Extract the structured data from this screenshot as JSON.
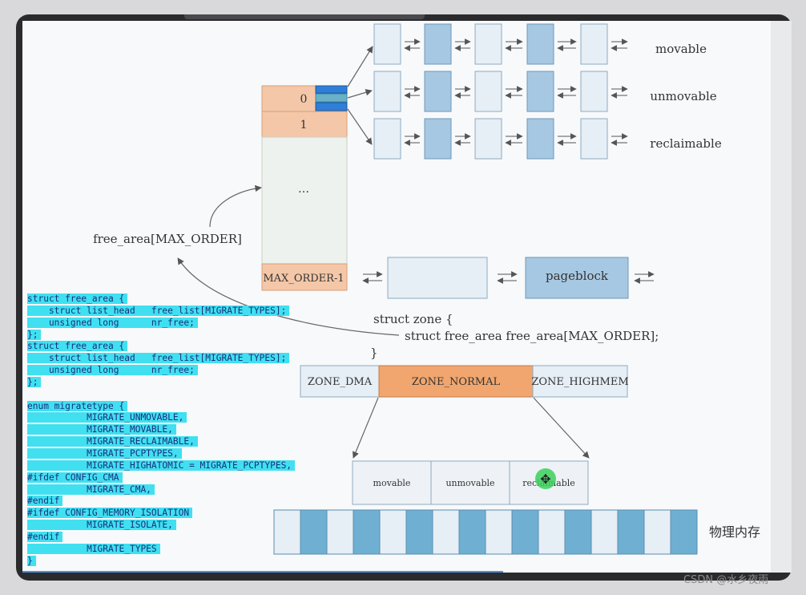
{
  "free_area_column": {
    "order_labels": [
      "0",
      "1",
      "…",
      "MAX_ORDER-1"
    ]
  },
  "migrate_rows": [
    {
      "label": "movable"
    },
    {
      "label": "unmovable"
    },
    {
      "label": "reclaimable"
    }
  ],
  "free_area_label": "free_area[MAX_ORDER]",
  "pageblock_label": "pageblock",
  "struct_zone": {
    "line1": "struct zone {",
    "line2": "struct free_area free_area[MAX_ORDER];",
    "line3": "}"
  },
  "zones": [
    "ZONE_DMA",
    "ZONE_NORMAL",
    "ZONE_HIGHMEM"
  ],
  "migrate_boxes": [
    "movable",
    "unmovable",
    "reclaimable"
  ],
  "physical_memory_label": "物理内存",
  "code_lines": [
    "struct free_area {",
    "    struct list_head   free_list[MIGRATE_TYPES];",
    "    unsigned long      nr_free;",
    "};",
    "struct free_area {",
    "    struct list_head   free_list[MIGRATE_TYPES];",
    "    unsigned long      nr_free;",
    "};",
    "",
    "enum migratetype {",
    "           MIGRATE_UNMOVABLE,",
    "           MIGRATE_MOVABLE,",
    "           MIGRATE_RECLAIMABLE,",
    "           MIGRATE_PCPTYPES,",
    "           MIGRATE_HIGHATOMIC = MIGRATE_PCPTYPES,",
    "#ifdef CONFIG_CMA",
    "           MIGRATE_CMA,",
    "#endif",
    "#ifdef CONFIG_MEMORY_ISOLATION",
    "           MIGRATE_ISOLATE,",
    "#endif",
    "           MIGRATE_TYPES",
    "}"
  ],
  "watermark": "CSDN @水乡夜雨",
  "colors": {
    "orange": "#f4c7a8",
    "orange_dark": "#f0a66e",
    "blue": "#a7c8e2",
    "blue_dark": "#6fb0d2",
    "light": "#e6eef6",
    "highlight": "#40e0f0"
  }
}
